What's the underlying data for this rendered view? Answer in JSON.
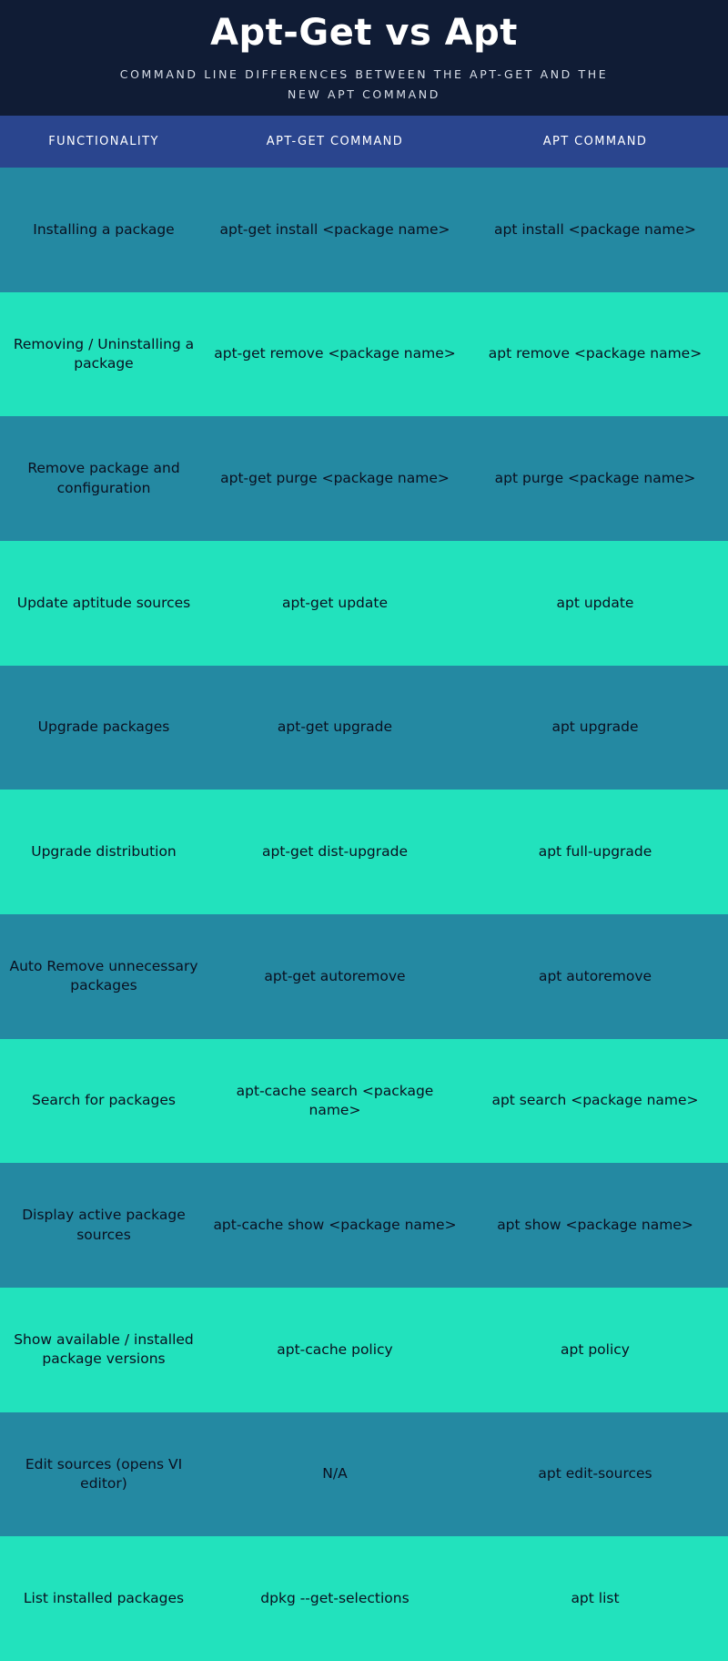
{
  "header": {
    "title": "Apt-Get vs Apt",
    "subtitle": "COMMAND LINE DIFFERENCES BETWEEN THE APT-GET AND THE NEW APT COMMAND",
    "background_color": "#101c35",
    "title_color": "#ffffff",
    "subtitle_color": "#d9dfe9"
  },
  "table": {
    "header_band_color": "#2a458e",
    "header_text_color": "#ffffff",
    "row_color_odd": "#2489a2",
    "row_color_even": "#22e2bd",
    "cell_text_color": "#0a1020",
    "columns": [
      "FUNCTIONALITY",
      "APT-GET  COMMAND",
      "APT COMMAND"
    ],
    "rows": [
      {
        "functionality": "Installing a package",
        "apt_get": "apt-get install <package name>",
        "apt": "apt install <package name>"
      },
      {
        "functionality": "Removing / Uninstalling a package",
        "apt_get": "apt-get remove <package name>",
        "apt": "apt remove <package name>"
      },
      {
        "functionality": "Remove package and configuration",
        "apt_get": "apt-get purge <package name>",
        "apt": "apt purge <package name>"
      },
      {
        "functionality": "Update aptitude sources",
        "apt_get": "apt-get update",
        "apt": "apt update"
      },
      {
        "functionality": "Upgrade packages",
        "apt_get": "apt-get upgrade",
        "apt": "apt upgrade"
      },
      {
        "functionality": "Upgrade distribution",
        "apt_get": "apt-get dist-upgrade",
        "apt": "apt full-upgrade"
      },
      {
        "functionality": "Auto Remove unnecessary packages",
        "apt_get": "apt-get autoremove",
        "apt": "apt autoremove"
      },
      {
        "functionality": "Search for packages",
        "apt_get": "apt-cache search <package name>",
        "apt": "apt search <package name>"
      },
      {
        "functionality": "Display active package sources",
        "apt_get": "apt-cache show <package name>",
        "apt": "apt show <package name>"
      },
      {
        "functionality": "Show available / installed package versions",
        "apt_get": "apt-cache policy",
        "apt": "apt policy"
      },
      {
        "functionality": "Edit sources (opens VI editor)",
        "apt_get": "N/A",
        "apt": "apt edit-sources"
      },
      {
        "functionality": "List installed packages",
        "apt_get": "dpkg --get-selections",
        "apt": "apt list"
      }
    ]
  }
}
